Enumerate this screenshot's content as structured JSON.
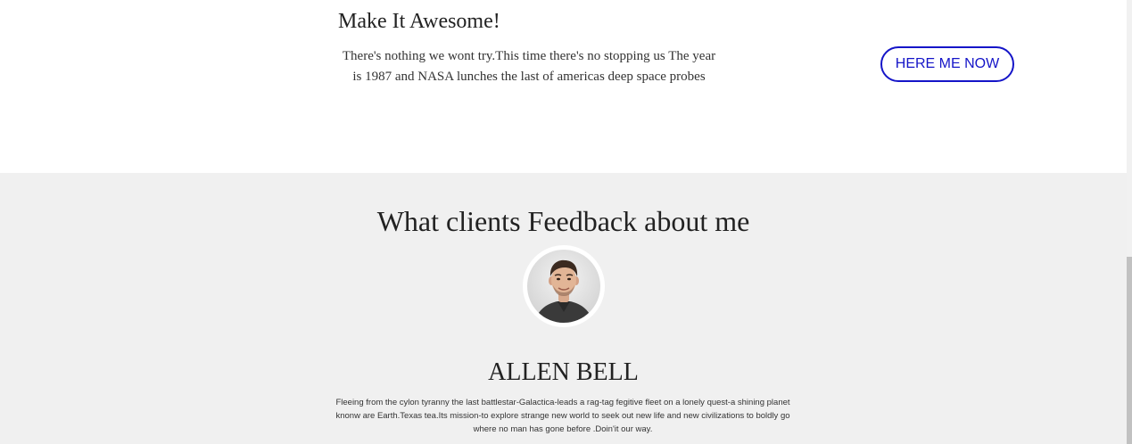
{
  "cta": {
    "title": "Make It Awesome!",
    "text": "There's nothing we wont try.This time there's no stopping us The year is 1987 and NASA lunches the last of americas deep space probes",
    "button_label": "HERE ME NOW"
  },
  "feedback": {
    "title": "What clients Feedback about me",
    "client": {
      "name": "ALLEN BELL",
      "testimonial": "Fleeing from the cylon tyranny the last battlestar-Galactica-leads a rag-tag fegitive fleet on a lonely quest-a shining planet knonw are Earth.Texas tea.Its mission-to explore strange new world to seek out new life and new civilizations to boldly go where no man has gone before .Doin'it our way."
    }
  },
  "colors": {
    "accent": "#1515c8",
    "section_bg": "#f0f0f0",
    "text": "#222222"
  }
}
